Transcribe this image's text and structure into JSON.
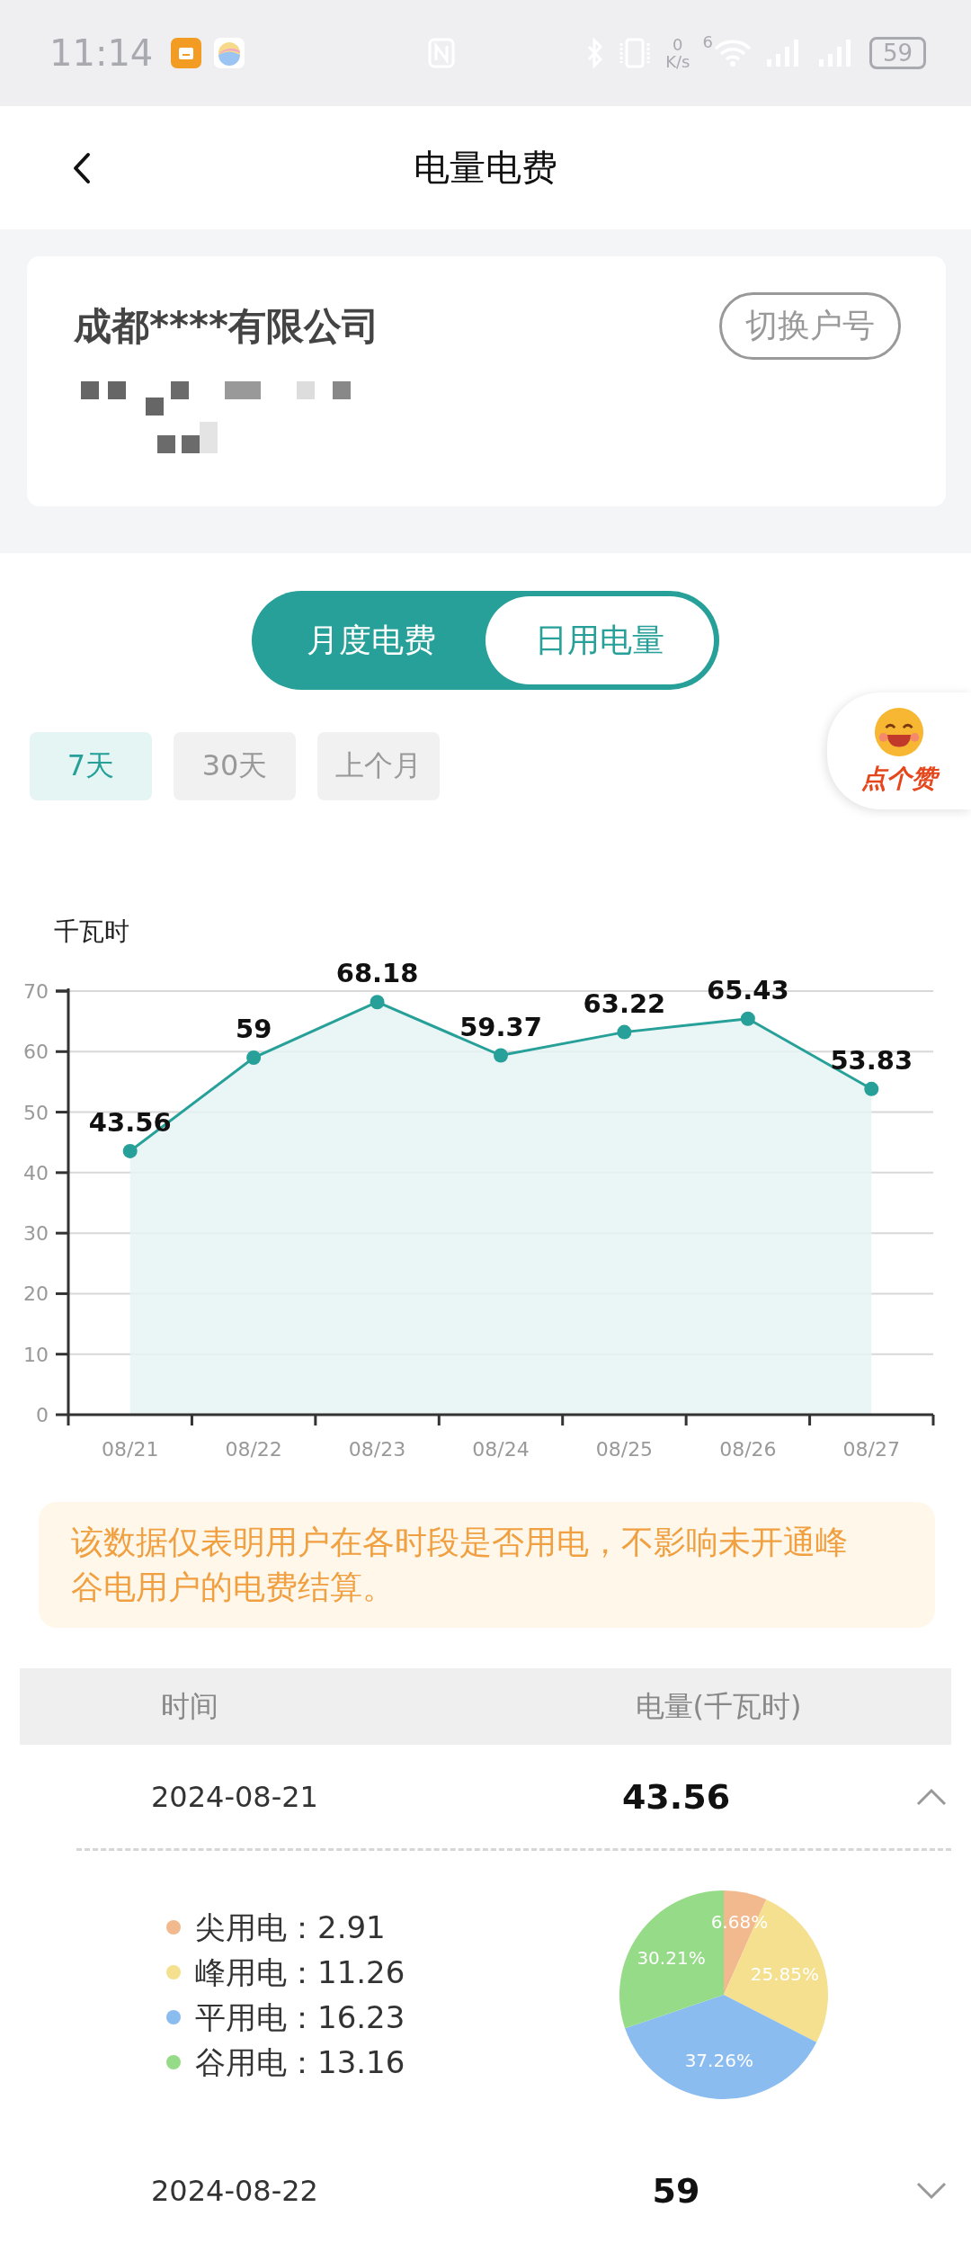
{
  "status_bar": {
    "time": "11:14",
    "net_speed_value": "0",
    "net_speed_unit": "K/s",
    "wifi_label": "6",
    "battery": "59"
  },
  "header": {
    "title": "电量电费"
  },
  "account": {
    "company": "成都****有限公司",
    "switch_button": "切换户号"
  },
  "like_badge": {
    "label": "点个赞"
  },
  "mode_tabs": [
    {
      "label": "月度电费",
      "selected": false
    },
    {
      "label": "日用电量",
      "selected": true
    }
  ],
  "range_chips": [
    {
      "label": "7天",
      "selected": true
    },
    {
      "label": "30天",
      "selected": false
    },
    {
      "label": "上个月",
      "selected": false
    }
  ],
  "chart": {
    "chart_data": {
      "type": "area",
      "ylabel": "千瓦时",
      "categories": [
        "08/21",
        "08/22",
        "08/23",
        "08/24",
        "08/25",
        "08/26",
        "08/27"
      ],
      "series": [
        {
          "color": "#26a098",
          "values": [
            43.56,
            59,
            68.18,
            59.37,
            63.22,
            65.43,
            53.83
          ]
        }
      ],
      "ylim": [
        0,
        70
      ],
      "yticks": [
        0,
        10,
        20,
        30,
        40,
        50,
        60,
        70
      ],
      "grid": true,
      "data_labels": true
    }
  },
  "notice": "该数据仅表明用户在各时段是否用电，不影响未开通峰谷电用户的电费结算。",
  "table": {
    "columns": [
      "时间",
      "电量(千瓦时)"
    ],
    "rows": [
      {
        "date": "2024-08-21",
        "value": "43.56",
        "expanded": true,
        "breakdown": [
          {
            "label": "尖用电：",
            "value": "2.91",
            "color": "#f2b98e"
          },
          {
            "label": "峰用电：",
            "value": "11.26",
            "color": "#f4e08e"
          },
          {
            "label": "平用电：",
            "value": "16.23",
            "color": "#8bbcf0"
          },
          {
            "label": "谷用电：",
            "value": "13.16",
            "color": "#96dc88"
          }
        ],
        "pie": {
          "chart_data": {
            "type": "pie",
            "values": [
              6.68,
              25.85,
              37.26,
              30.21
            ],
            "value_labels": [
              "6.68%",
              "25.85%",
              "37.26%",
              "30.21%"
            ]
          }
        }
      },
      {
        "date": "2024-08-22",
        "value": "59",
        "expanded": false
      }
    ]
  }
}
